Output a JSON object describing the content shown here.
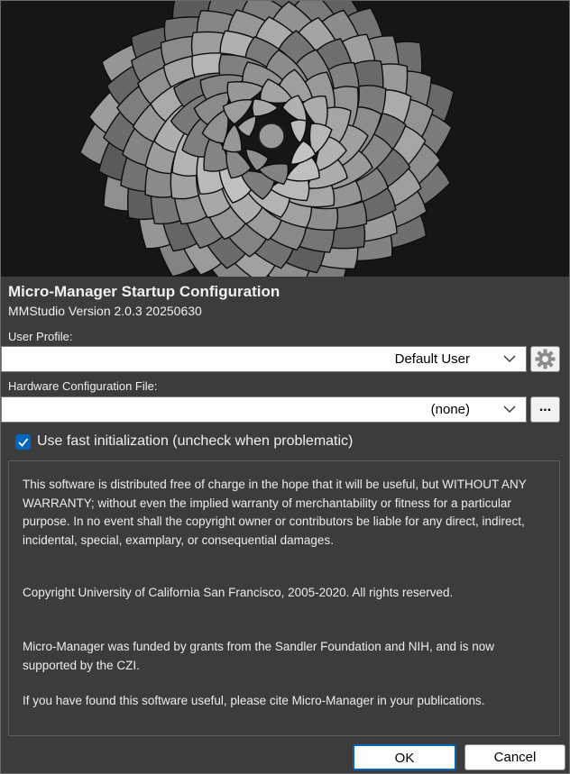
{
  "dialog": {
    "title": "Micro-Manager Startup Configuration",
    "version": "MMStudio Version 2.0.3 20250630"
  },
  "user_profile": {
    "label": "User Profile:",
    "selected": "Default User",
    "settings_icon": "gear-icon"
  },
  "hardware_config": {
    "label": "Hardware Configuration File:",
    "selected": "(none)",
    "browse_label": "..."
  },
  "fast_init": {
    "label": "Use fast initialization (uncheck when problematic)",
    "checked": true
  },
  "license": {
    "p1": "This software is distributed free of charge in the hope that it will be useful, but WITHOUT ANY WARRANTY; without even the implied warranty of merchantability or fitness for a particular purpose. In no event shall the copyright owner or contributors be liable for any direct, indirect, incidental, special, examplary, or consequential damages.",
    "p2": "Copyright University of California San Francisco, 2005-2020. All rights reserved.",
    "p3": "Micro-Manager was funded by grants from the Sandler Foundation and NIH, and is now supported by the CZI.",
    "p4": "If you have found this software useful, please cite Micro-Manager in your publications."
  },
  "buttons": {
    "ok": "OK",
    "cancel": "Cancel"
  },
  "colors": {
    "background": "#3c3c3c",
    "accent": "#0067c0"
  }
}
